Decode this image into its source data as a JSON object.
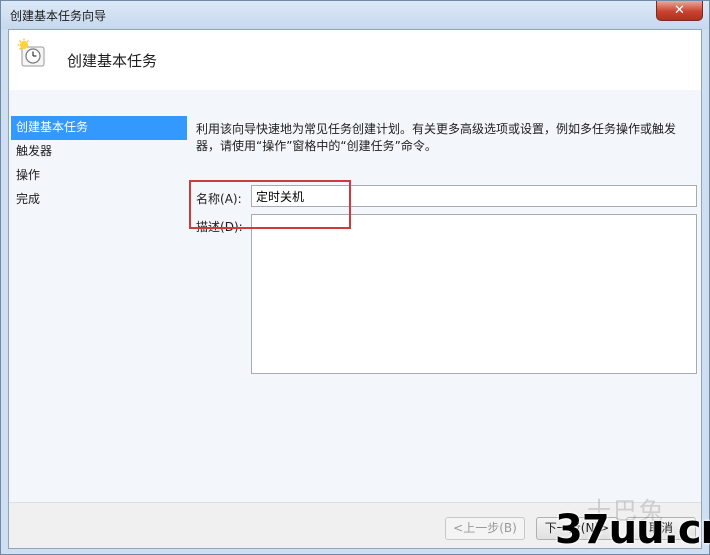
{
  "window": {
    "title": "创建基本任务向导",
    "close_label": "✕"
  },
  "header": {
    "title": "创建基本任务",
    "icon": "clock-task-icon"
  },
  "nav": {
    "items": [
      {
        "label": "创建基本任务",
        "selected": true
      },
      {
        "label": "触发器",
        "selected": false
      },
      {
        "label": "操作",
        "selected": false
      },
      {
        "label": "完成",
        "selected": false
      }
    ]
  },
  "content": {
    "description_line1": "利用该向导快速地为常见任务创建计划。有关更多高级选项或设置，例如多任务操作或触发",
    "description_line2": "器，请使用“操作”窗格中的“创建任务”命令。",
    "name_label": "名称",
    "name_accel": "(A):",
    "name_value": "定时关机",
    "desc_label": "描述",
    "desc_accel": "(D):",
    "desc_value": ""
  },
  "footer": {
    "back_label": "<上一步(B)",
    "next_label": "下一步(N)>",
    "cancel_label": "取消"
  },
  "watermark": {
    "ghost_text": "十巴兔",
    "text": "37uu.cn"
  },
  "colors": {
    "selection": "#3399ff",
    "highlight_box": "#d23a3a",
    "close_button": "#c7432f"
  }
}
